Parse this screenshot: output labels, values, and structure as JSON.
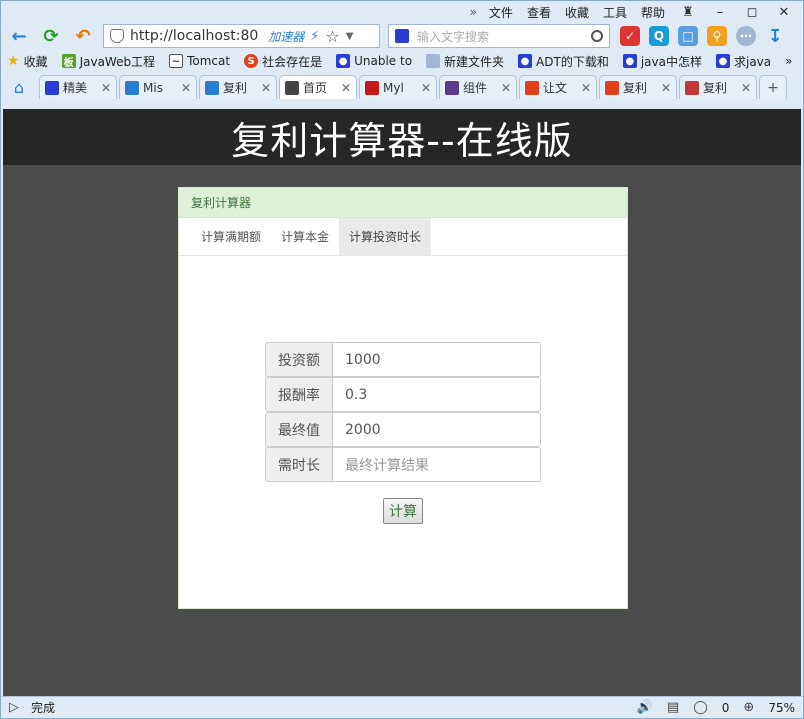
{
  "menubar": {
    "more": "»",
    "items": [
      "文件",
      "查看",
      "收藏",
      "工具",
      "帮助"
    ]
  },
  "navbar": {
    "url": "http://localhost:80",
    "accelerator": "加速器",
    "search_placeholder": "输入文字搜索"
  },
  "bookmarks": [
    {
      "label": "收藏"
    },
    {
      "label": "JavaWeb工程"
    },
    {
      "label": "Tomcat"
    },
    {
      "label": "社会存在是"
    },
    {
      "label": "Unable to"
    },
    {
      "label": "新建文件夹"
    },
    {
      "label": "ADT的下载和"
    },
    {
      "label": "java中怎样"
    },
    {
      "label": "求java"
    }
  ],
  "tabs": [
    {
      "label": "精美",
      "color": "#2b3bd6"
    },
    {
      "label": "Mis",
      "color": "#2a7fd4"
    },
    {
      "label": "复利",
      "color": "#2a7fd4"
    },
    {
      "label": "首页",
      "color": "#444444"
    },
    {
      "label": "Myl",
      "color": "#c41a1a"
    },
    {
      "label": "组件",
      "color": "#5b3a8c"
    },
    {
      "label": "让文",
      "color": "#e2401c"
    },
    {
      "label": "复利",
      "color": "#e2401c"
    },
    {
      "label": "复利",
      "color": "#c23b3b"
    }
  ],
  "page": {
    "header_title": "复利计算器--在线版",
    "panel_title": "复利计算器",
    "nav_tabs": [
      "计算满期额",
      "计算本金",
      "计算投资时长"
    ],
    "form": {
      "invest_label": "投资额",
      "invest_value": "1000",
      "rate_label": "报酬率",
      "rate_value": "0.3",
      "final_label": "最终值",
      "final_value": "2000",
      "time_label": "需时长",
      "time_placeholder": "最终计算结果",
      "calc_label": "计算"
    }
  },
  "status": {
    "text": "完成",
    "count": "0",
    "zoom": "75%"
  },
  "colors": {
    "accent": "#2a7fd4",
    "panel_header_bg": "#dff0d8",
    "panel_header_text": "#3c763d",
    "page_bg": "#4b4b4b",
    "header_bg": "#262626"
  }
}
